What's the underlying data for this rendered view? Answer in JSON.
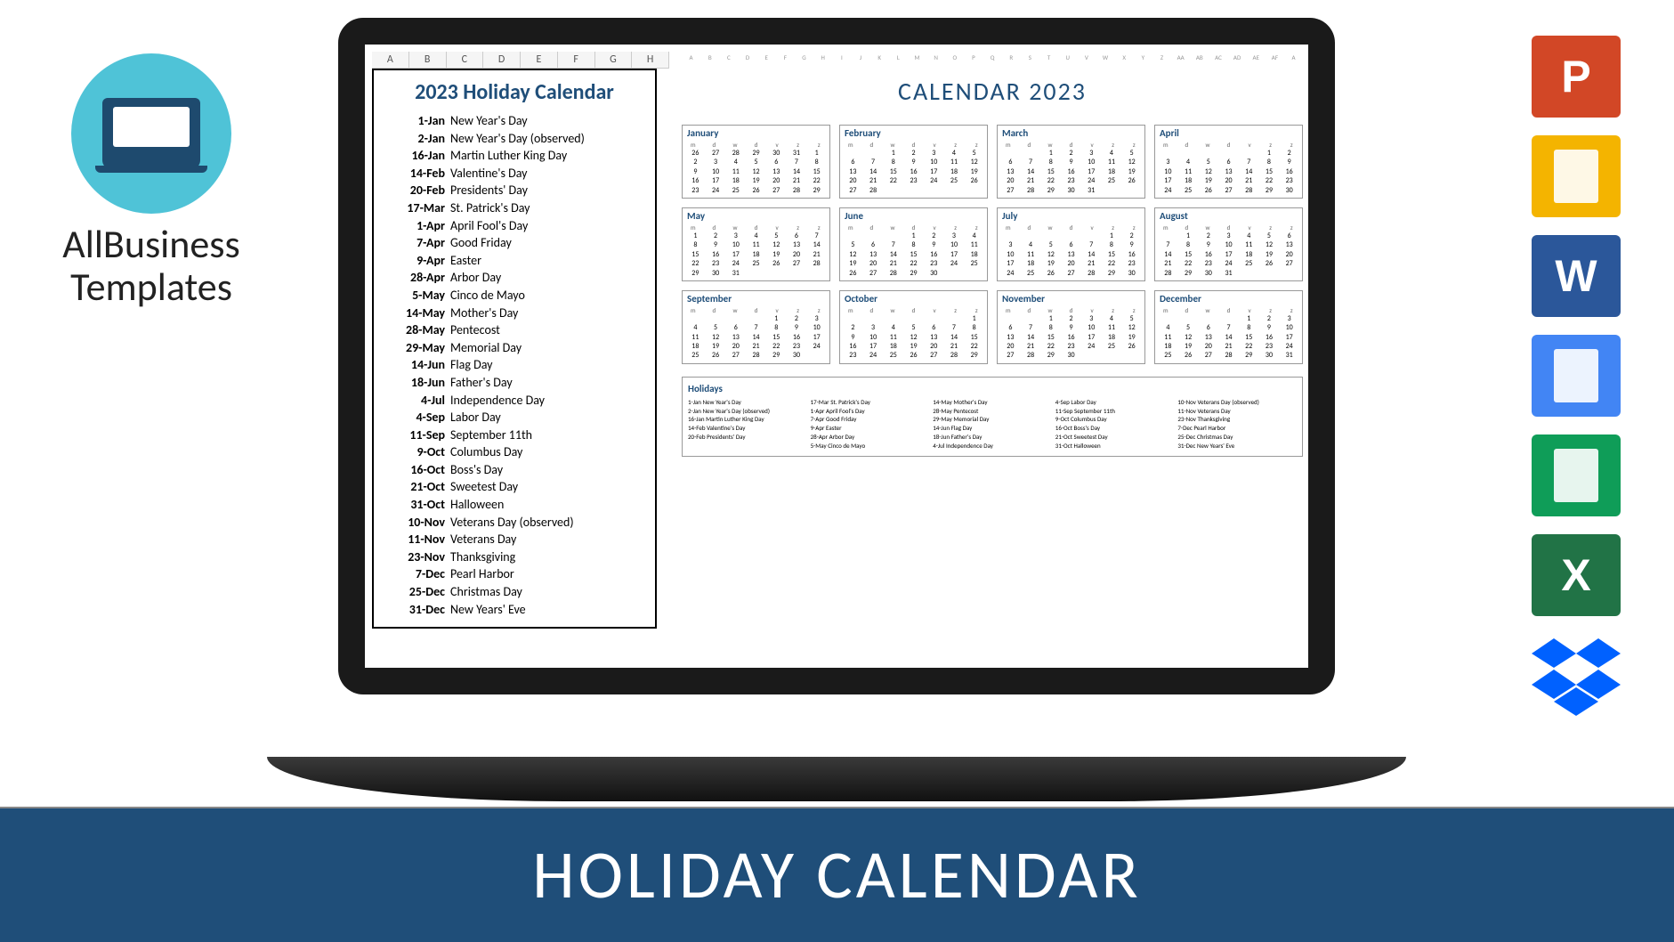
{
  "logo": {
    "line1": "AllBusiness",
    "line2": "Templates"
  },
  "banner": "HOLIDAY CALENDAR",
  "left_cols": [
    "A",
    "B",
    "C",
    "D",
    "E",
    "F",
    "G",
    "H"
  ],
  "mini_cols": [
    "A",
    "B",
    "C",
    "D",
    "E",
    "F",
    "G",
    "H",
    "I",
    "J",
    "K",
    "L",
    "M",
    "N",
    "O",
    "P",
    "Q",
    "R",
    "S",
    "T",
    "U",
    "V",
    "W",
    "X",
    "Y",
    "Z",
    "AA",
    "AB",
    "AC",
    "AD",
    "AE",
    "AF",
    "A"
  ],
  "holiday_list": {
    "title": "2023 Holiday Calendar",
    "items": [
      {
        "d": "1-Jan",
        "n": "New Year's Day"
      },
      {
        "d": "2-Jan",
        "n": "New Year's Day (observed)"
      },
      {
        "d": "16-Jan",
        "n": "Martin Luther King Day"
      },
      {
        "d": "14-Feb",
        "n": "Valentine's Day"
      },
      {
        "d": "20-Feb",
        "n": "Presidents' Day"
      },
      {
        "d": "17-Mar",
        "n": "St. Patrick's Day"
      },
      {
        "d": "1-Apr",
        "n": "April Fool's Day"
      },
      {
        "d": "7-Apr",
        "n": "Good Friday"
      },
      {
        "d": "9-Apr",
        "n": "Easter"
      },
      {
        "d": "28-Apr",
        "n": "Arbor Day"
      },
      {
        "d": "5-May",
        "n": "Cinco de Mayo"
      },
      {
        "d": "14-May",
        "n": "Mother's Day"
      },
      {
        "d": "28-May",
        "n": "Pentecost"
      },
      {
        "d": "29-May",
        "n": "Memorial Day"
      },
      {
        "d": "14-Jun",
        "n": "Flag Day"
      },
      {
        "d": "18-Jun",
        "n": "Father's Day"
      },
      {
        "d": "4-Jul",
        "n": "Independence Day"
      },
      {
        "d": "4-Sep",
        "n": "Labor Day"
      },
      {
        "d": "11-Sep",
        "n": "September 11th"
      },
      {
        "d": "9-Oct",
        "n": "Columbus Day"
      },
      {
        "d": "16-Oct",
        "n": "Boss's Day"
      },
      {
        "d": "21-Oct",
        "n": "Sweetest Day"
      },
      {
        "d": "31-Oct",
        "n": "Halloween"
      },
      {
        "d": "10-Nov",
        "n": "Veterans Day (observed)"
      },
      {
        "d": "11-Nov",
        "n": "Veterans Day"
      },
      {
        "d": "23-Nov",
        "n": "Thanksgiving"
      },
      {
        "d": "7-Dec",
        "n": "Pearl Harbor"
      },
      {
        "d": "25-Dec",
        "n": "Christmas Day"
      },
      {
        "d": "31-Dec",
        "n": "New Years' Eve"
      }
    ]
  },
  "calendar": {
    "title": "CALENDAR 2023",
    "dow": [
      "m",
      "d",
      "w",
      "d",
      "v",
      "z",
      "z"
    ],
    "months": [
      {
        "name": "January",
        "weeks": [
          [
            "26",
            "27",
            "28",
            "29",
            "30",
            "31",
            "1"
          ],
          [
            "2",
            "3",
            "4",
            "5",
            "6",
            "7",
            "8"
          ],
          [
            "9",
            "10",
            "11",
            "12",
            "13",
            "14",
            "15"
          ],
          [
            "16",
            "17",
            "18",
            "19",
            "20",
            "21",
            "22"
          ],
          [
            "23",
            "24",
            "25",
            "26",
            "27",
            "28",
            "29"
          ]
        ]
      },
      {
        "name": "February",
        "weeks": [
          [
            "",
            "",
            "1",
            "2",
            "3",
            "4",
            "5"
          ],
          [
            "6",
            "7",
            "8",
            "9",
            "10",
            "11",
            "12"
          ],
          [
            "13",
            "14",
            "15",
            "16",
            "17",
            "18",
            "19"
          ],
          [
            "20",
            "21",
            "22",
            "23",
            "24",
            "25",
            "26"
          ],
          [
            "27",
            "28",
            "",
            "",
            "",
            "",
            ""
          ]
        ]
      },
      {
        "name": "March",
        "weeks": [
          [
            "",
            "",
            "1",
            "2",
            "3",
            "4",
            "5"
          ],
          [
            "6",
            "7",
            "8",
            "9",
            "10",
            "11",
            "12"
          ],
          [
            "13",
            "14",
            "15",
            "16",
            "17",
            "18",
            "19"
          ],
          [
            "20",
            "21",
            "22",
            "23",
            "24",
            "25",
            "26"
          ],
          [
            "27",
            "28",
            "29",
            "30",
            "31",
            "",
            ""
          ]
        ]
      },
      {
        "name": "April",
        "weeks": [
          [
            "",
            "",
            "",
            "",
            "",
            "1",
            "2"
          ],
          [
            "3",
            "4",
            "5",
            "6",
            "7",
            "8",
            "9"
          ],
          [
            "10",
            "11",
            "12",
            "13",
            "14",
            "15",
            "16"
          ],
          [
            "17",
            "18",
            "19",
            "20",
            "21",
            "22",
            "23"
          ],
          [
            "24",
            "25",
            "26",
            "27",
            "28",
            "29",
            "30"
          ]
        ]
      },
      {
        "name": "May",
        "weeks": [
          [
            "1",
            "2",
            "3",
            "4",
            "5",
            "6",
            "7"
          ],
          [
            "8",
            "9",
            "10",
            "11",
            "12",
            "13",
            "14"
          ],
          [
            "15",
            "16",
            "17",
            "18",
            "19",
            "20",
            "21"
          ],
          [
            "22",
            "23",
            "24",
            "25",
            "26",
            "27",
            "28"
          ],
          [
            "29",
            "30",
            "31",
            "",
            "",
            "",
            ""
          ]
        ]
      },
      {
        "name": "June",
        "weeks": [
          [
            "",
            "",
            "",
            "1",
            "2",
            "3",
            "4"
          ],
          [
            "5",
            "6",
            "7",
            "8",
            "9",
            "10",
            "11"
          ],
          [
            "12",
            "13",
            "14",
            "15",
            "16",
            "17",
            "18"
          ],
          [
            "19",
            "20",
            "21",
            "22",
            "23",
            "24",
            "25"
          ],
          [
            "26",
            "27",
            "28",
            "29",
            "30",
            "",
            ""
          ]
        ]
      },
      {
        "name": "July",
        "weeks": [
          [
            "",
            "",
            "",
            "",
            "",
            "1",
            "2"
          ],
          [
            "3",
            "4",
            "5",
            "6",
            "7",
            "8",
            "9"
          ],
          [
            "10",
            "11",
            "12",
            "13",
            "14",
            "15",
            "16"
          ],
          [
            "17",
            "18",
            "19",
            "20",
            "21",
            "22",
            "23"
          ],
          [
            "24",
            "25",
            "26",
            "27",
            "28",
            "29",
            "30"
          ]
        ]
      },
      {
        "name": "August",
        "weeks": [
          [
            "",
            "1",
            "2",
            "3",
            "4",
            "5",
            "6"
          ],
          [
            "7",
            "8",
            "9",
            "10",
            "11",
            "12",
            "13"
          ],
          [
            "14",
            "15",
            "16",
            "17",
            "18",
            "19",
            "20"
          ],
          [
            "21",
            "22",
            "23",
            "24",
            "25",
            "26",
            "27"
          ],
          [
            "28",
            "29",
            "30",
            "31",
            "",
            "",
            ""
          ]
        ]
      },
      {
        "name": "September",
        "weeks": [
          [
            "",
            "",
            "",
            "",
            "1",
            "2",
            "3"
          ],
          [
            "4",
            "5",
            "6",
            "7",
            "8",
            "9",
            "10"
          ],
          [
            "11",
            "12",
            "13",
            "14",
            "15",
            "16",
            "17"
          ],
          [
            "18",
            "19",
            "20",
            "21",
            "22",
            "23",
            "24"
          ],
          [
            "25",
            "26",
            "27",
            "28",
            "29",
            "30",
            ""
          ]
        ]
      },
      {
        "name": "October",
        "weeks": [
          [
            "",
            "",
            "",
            "",
            "",
            "",
            "1"
          ],
          [
            "2",
            "3",
            "4",
            "5",
            "6",
            "7",
            "8"
          ],
          [
            "9",
            "10",
            "11",
            "12",
            "13",
            "14",
            "15"
          ],
          [
            "16",
            "17",
            "18",
            "19",
            "20",
            "21",
            "22"
          ],
          [
            "23",
            "24",
            "25",
            "26",
            "27",
            "28",
            "29"
          ]
        ]
      },
      {
        "name": "November",
        "weeks": [
          [
            "",
            "",
            "1",
            "2",
            "3",
            "4",
            "5"
          ],
          [
            "6",
            "7",
            "8",
            "9",
            "10",
            "11",
            "12"
          ],
          [
            "13",
            "14",
            "15",
            "16",
            "17",
            "18",
            "19"
          ],
          [
            "20",
            "21",
            "22",
            "23",
            "24",
            "25",
            "26"
          ],
          [
            "27",
            "28",
            "29",
            "30",
            "",
            "",
            ""
          ]
        ]
      },
      {
        "name": "December",
        "weeks": [
          [
            "",
            "",
            "",
            "",
            "1",
            "2",
            "3"
          ],
          [
            "4",
            "5",
            "6",
            "7",
            "8",
            "9",
            "10"
          ],
          [
            "11",
            "12",
            "13",
            "14",
            "15",
            "16",
            "17"
          ],
          [
            "18",
            "19",
            "20",
            "21",
            "22",
            "23",
            "24"
          ],
          [
            "25",
            "26",
            "27",
            "28",
            "29",
            "30",
            "31"
          ]
        ]
      }
    ],
    "holidays_box": {
      "title": "Holidays",
      "cols": [
        [
          "1-Jan New Year's Day",
          "2-Jan New Year's Day (observed)",
          "16-Jan Martin Luther King Day",
          "14-Feb Valentine's Day",
          "20-Feb Presidents' Day"
        ],
        [
          "17-Mar St. Patrick's Day",
          "1-Apr April Fool's Day",
          "7-Apr Good Friday",
          "9-Apr Easter",
          "28-Apr Arbor Day",
          "5-May Cinco de Mayo"
        ],
        [
          "14-May Mother's Day",
          "28-May Pentecost",
          "29-May Memorial Day",
          "14-Jun Flag Day",
          "18-Jun Father's Day",
          "4-Jul Independence Day"
        ],
        [
          "4-Sep Labor Day",
          "11-Sep September 11th",
          "9-Oct Columbus Day",
          "16-Oct Boss's Day",
          "21-Oct Sweetest Day",
          "31-Oct Halloween"
        ],
        [
          "10-Nov Veterans Day (observed)",
          "11-Nov Veterans Day",
          "23-Nov Thanksgiving",
          "7-Dec Pearl Harbor",
          "25-Dec Christmas Day",
          "31-Dec New Years' Eve"
        ]
      ]
    }
  },
  "icons": [
    {
      "name": "powerpoint-icon",
      "letter": "P",
      "bg": "#d24726"
    },
    {
      "name": "google-slides-icon",
      "letter": "",
      "bg": "#f4b400"
    },
    {
      "name": "word-icon",
      "letter": "W",
      "bg": "#2b579a"
    },
    {
      "name": "google-docs-icon",
      "letter": "",
      "bg": "#4285f4"
    },
    {
      "name": "google-sheets-icon",
      "letter": "",
      "bg": "#0f9d58"
    },
    {
      "name": "excel-icon",
      "letter": "X",
      "bg": "#217346"
    },
    {
      "name": "dropbox-icon",
      "letter": "",
      "bg": ""
    }
  ]
}
